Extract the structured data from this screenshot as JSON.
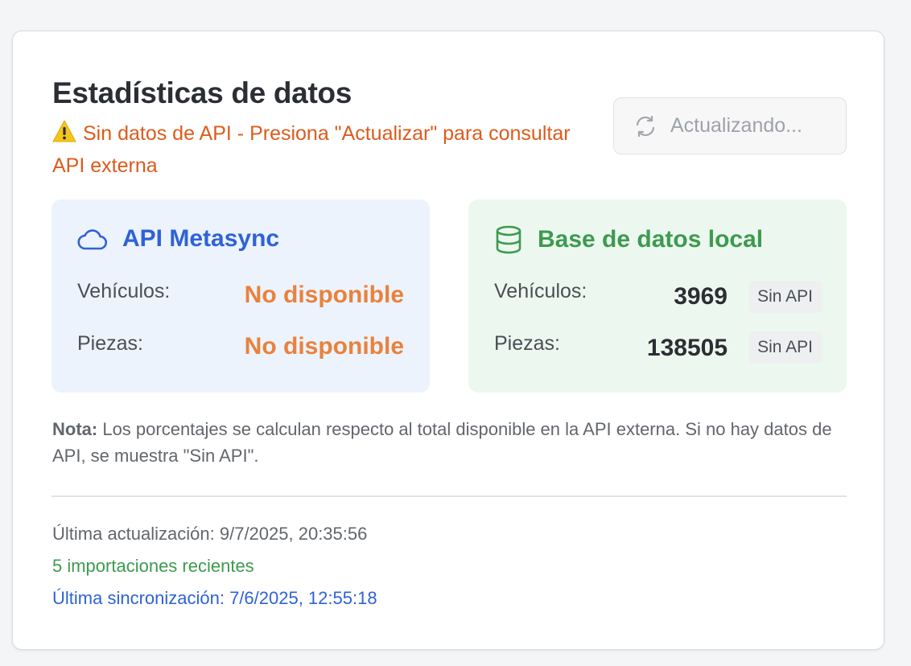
{
  "header": {
    "title": "Estadísticas de datos",
    "warning_icon": "warning-icon",
    "warning_text": "Sin datos de API - Presiona \"Actualizar\" para consultar API externa"
  },
  "refresh_button": {
    "icon": "refresh-icon",
    "label": "Actualizando...",
    "disabled": true
  },
  "api_panel": {
    "icon": "cloud-icon",
    "title": "API Metasync",
    "vehicles_label": "Vehículos:",
    "vehicles_value": "No disponible",
    "parts_label": "Piezas:",
    "parts_value": "No disponible"
  },
  "local_panel": {
    "icon": "database-icon",
    "title": "Base de datos local",
    "vehicles_label": "Vehículos:",
    "vehicles_value": "3969",
    "vehicles_badge": "Sin API",
    "parts_label": "Piezas:",
    "parts_value": "138505",
    "parts_badge": "Sin API"
  },
  "note": {
    "label": "Nota:",
    "text": " Los porcentajes se calculan respecto al total disponible en la API externa. Si no hay datos de API, se muestra \"Sin API\"."
  },
  "footer": {
    "last_update": "Última actualización: 9/7/2025, 20:35:56",
    "recent_imports": "5 importaciones recientes",
    "last_sync": "Última sincronización: 7/6/2025, 12:55:18"
  },
  "colors": {
    "warning": "#dc5b1c",
    "api_blue": "#2f62d6",
    "local_green": "#3d9a4f",
    "unavailable_orange": "#e8823d"
  }
}
